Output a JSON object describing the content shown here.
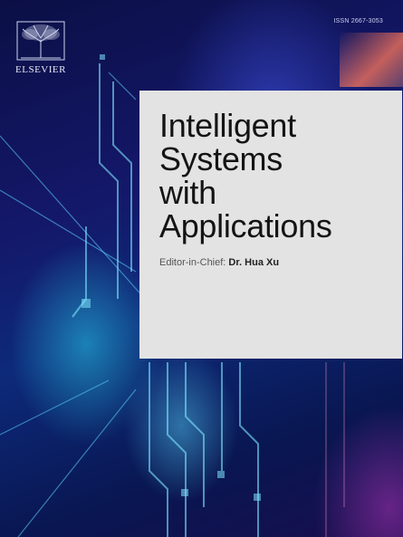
{
  "cover": {
    "publisher": "ELSEVIER",
    "issn": "ISSN 2667-3053",
    "title_lines": [
      "Intelligent",
      "Systems",
      "with",
      "Applications"
    ],
    "editor_label": "Editor-in-Chief:",
    "editor_name": "Dr. Hua Xu"
  },
  "colors": {
    "background": "#0b0f45",
    "panel": "#e3e3e3",
    "title_text": "#141414",
    "glow_cyan": "#38c8e6",
    "glow_blue": "#3c50dc",
    "glow_magenta": "#c83cc8",
    "glow_orange": "#ff785a"
  },
  "icons": {
    "logo": "elsevier-tree-icon"
  }
}
